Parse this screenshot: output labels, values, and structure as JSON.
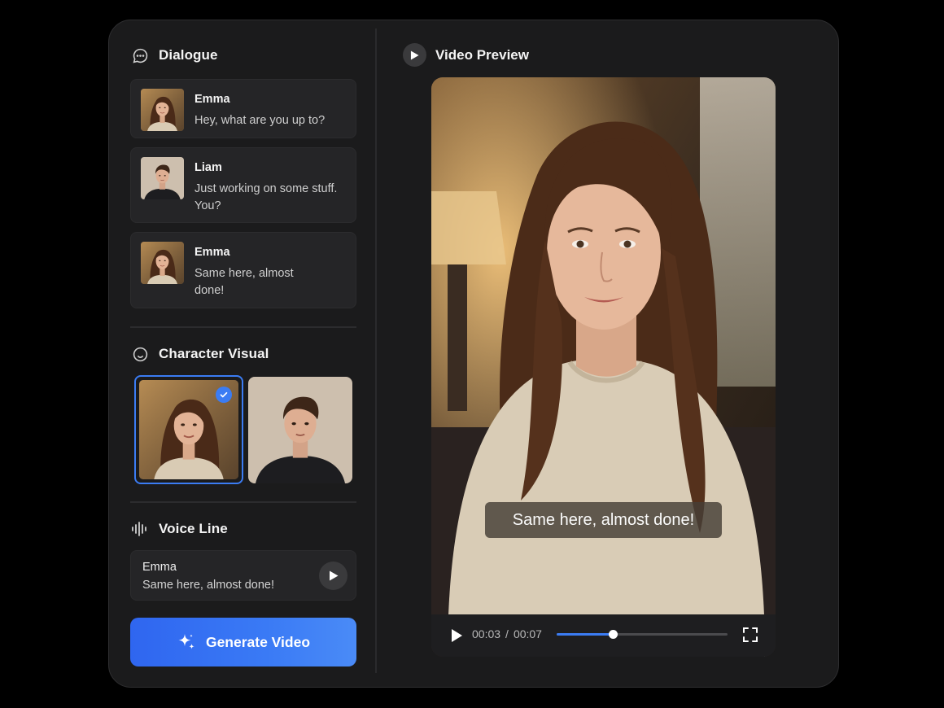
{
  "dialogue": {
    "title": "Dialogue",
    "messages": [
      {
        "name": "Emma",
        "text": "Hey, what are you up to?"
      },
      {
        "name": "Liam",
        "text": "Just working on some stuff. You?"
      },
      {
        "name": "Emma",
        "text": "Same here, almost done!"
      }
    ]
  },
  "character_visual": {
    "title": "Character Visual",
    "selected_index": 0
  },
  "voice_line": {
    "title": "Voice Line",
    "name": "Emma",
    "text": "Same here, almost done!"
  },
  "generate_button": {
    "label": "Generate Video"
  },
  "video_preview": {
    "title": "Video Preview",
    "caption": "Same here, almost done!",
    "current_time": "00:03",
    "separator": "/",
    "duration": "00:07",
    "progress": 0.33
  },
  "colors": {
    "accent": "#3b7cf3",
    "panel": "#1b1b1c",
    "card": "#252527"
  }
}
